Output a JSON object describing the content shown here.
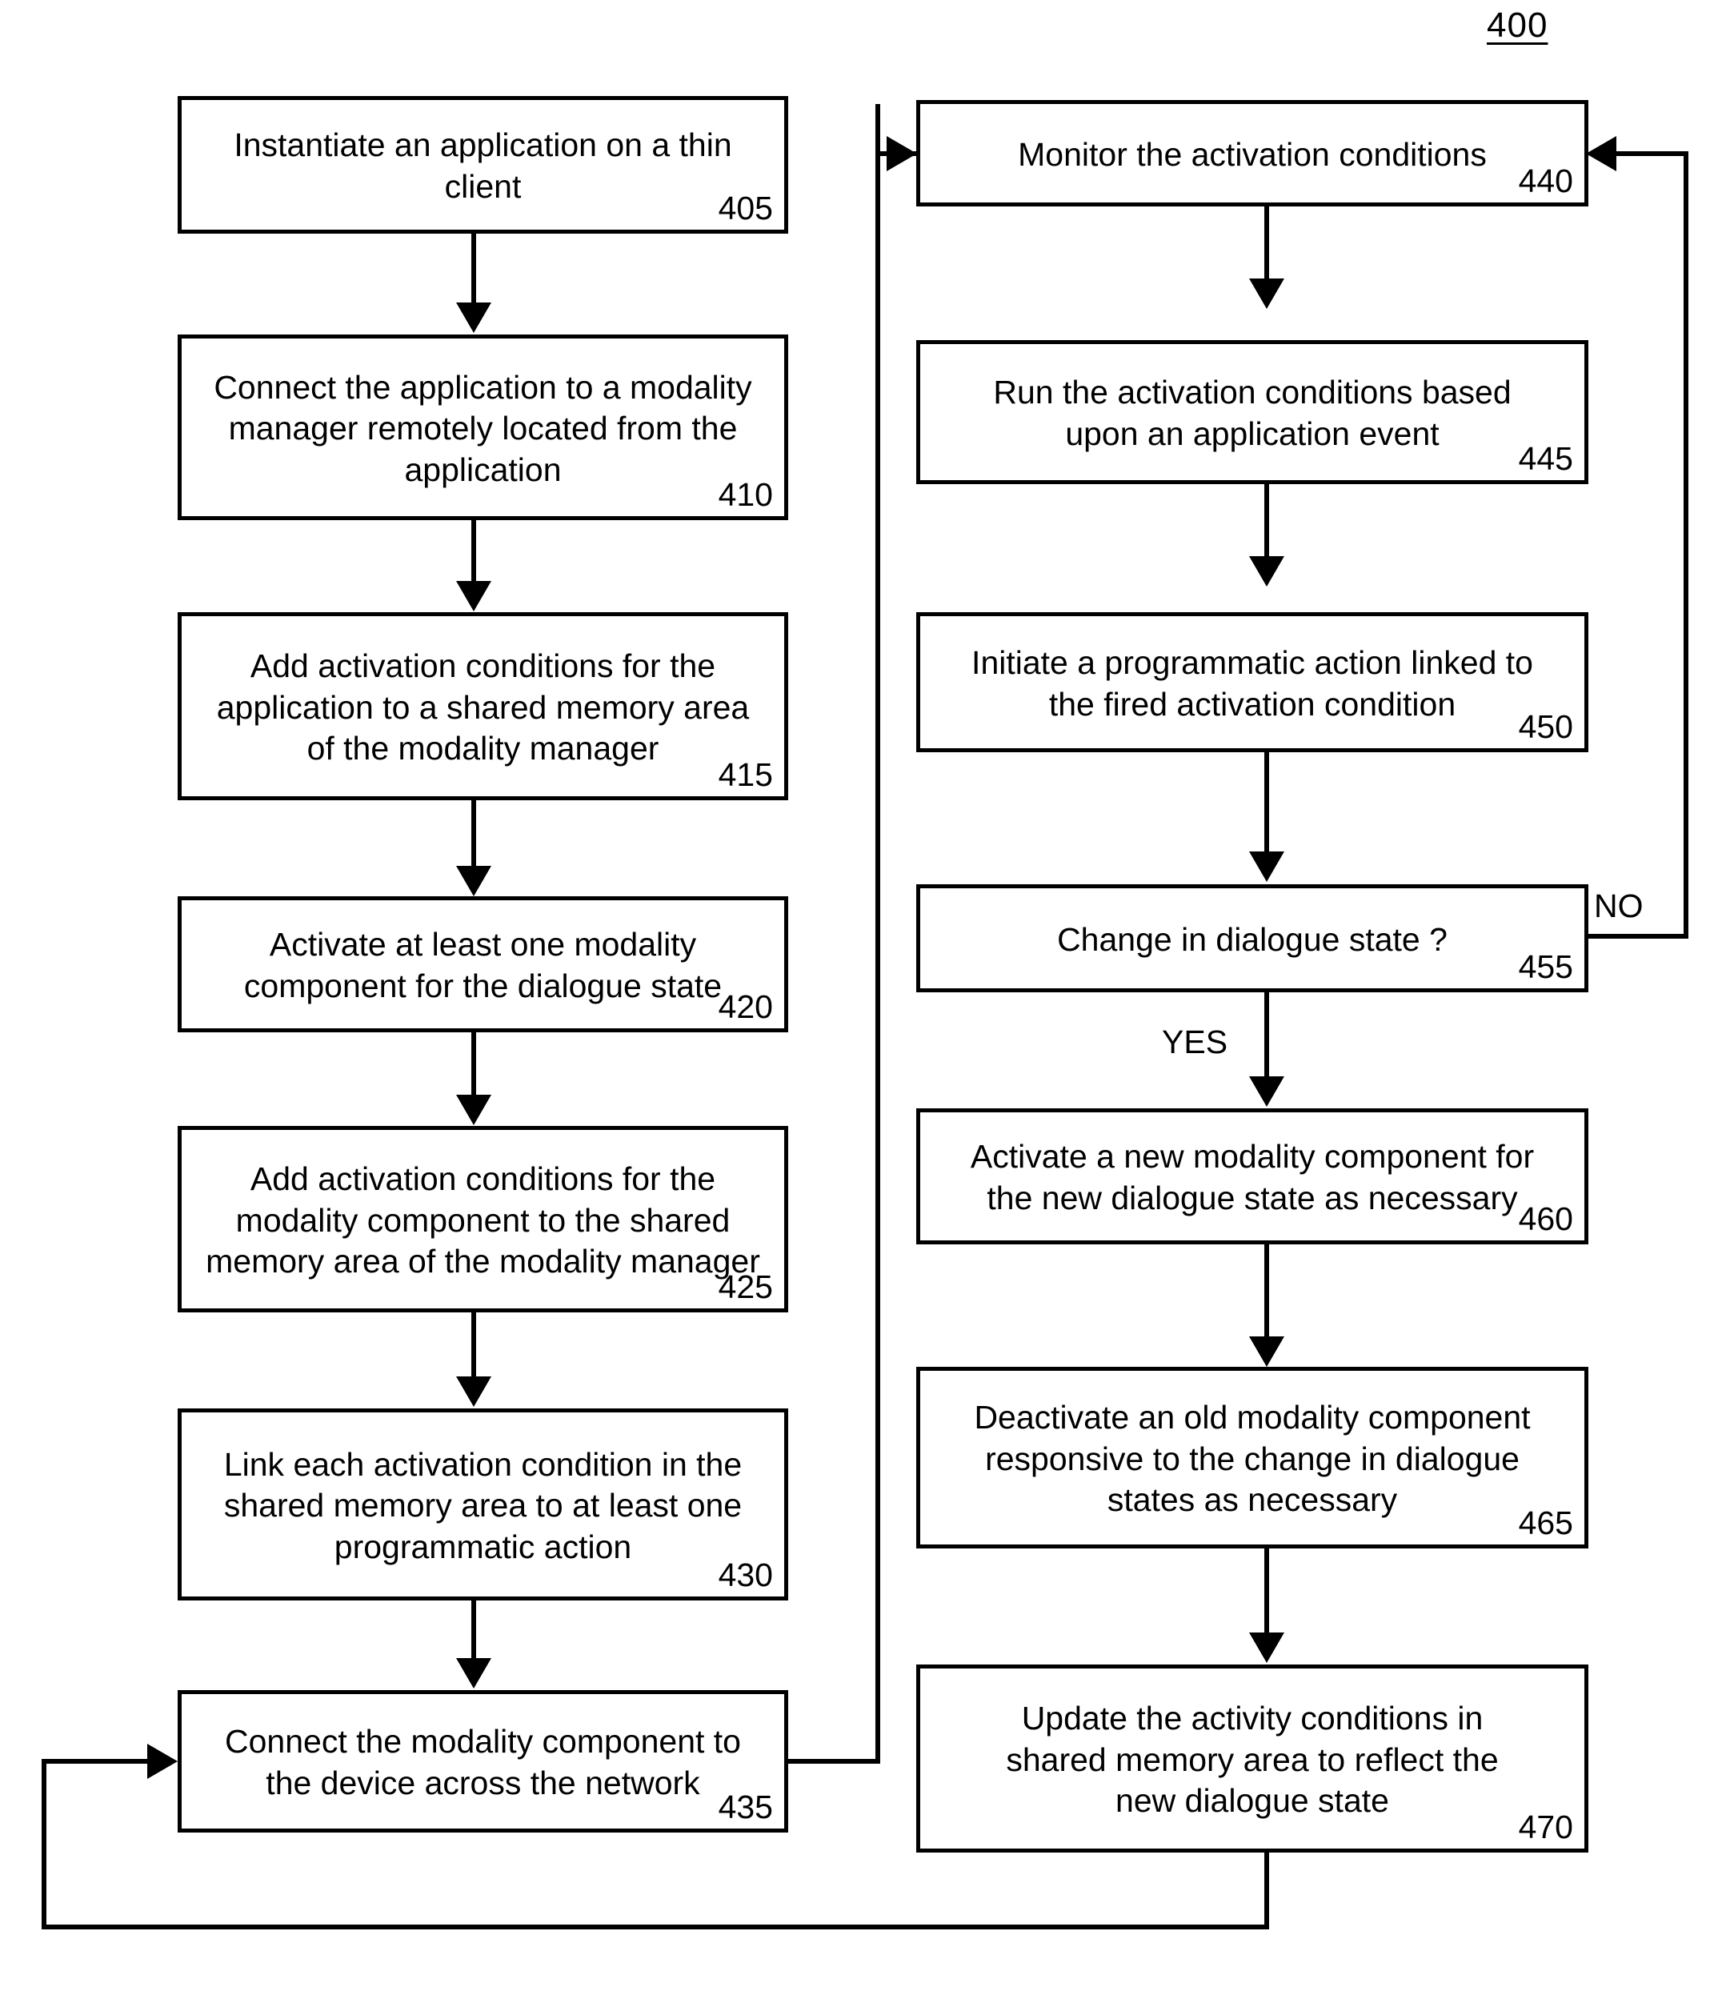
{
  "figure": {
    "number": "400"
  },
  "nodes": [
    {
      "id": "n405",
      "ref": "405",
      "text": "Instantiate an application on a thin\nclient"
    },
    {
      "id": "n410",
      "ref": "410",
      "text": "Connect the application to a modality\nmanager remotely located from the\napplication"
    },
    {
      "id": "n415",
      "ref": "415",
      "text": "Add activation conditions for the\napplication to a shared memory area\nof the modality manager"
    },
    {
      "id": "n420",
      "ref": "420",
      "text": "Activate at least one modality\ncomponent for the dialogue state"
    },
    {
      "id": "n425",
      "ref": "425",
      "text": "Add activation conditions for the\nmodality component to the shared\nmemory area of the modality manager"
    },
    {
      "id": "n430",
      "ref": "430",
      "text": "Link each activation condition in the\nshared memory area to at least one\nprogrammatic action"
    },
    {
      "id": "n435",
      "ref": "435",
      "text": "Connect the modality component to\nthe device across the network"
    },
    {
      "id": "n440",
      "ref": "440",
      "text": "Monitor the activation conditions"
    },
    {
      "id": "n445",
      "ref": "445",
      "text": "Run the activation conditions based\nupon an application event"
    },
    {
      "id": "n450",
      "ref": "450",
      "text": "Initiate a programmatic action linked to\nthe fired activation condition"
    },
    {
      "id": "n455",
      "ref": "455",
      "text": "Change in dialogue state ?"
    },
    {
      "id": "n460",
      "ref": "460",
      "text": "Activate a new modality component for\nthe new dialogue state as necessary"
    },
    {
      "id": "n465",
      "ref": "465",
      "text": "Deactivate an old modality component\nresponsive to the change in dialogue\nstates as necessary"
    },
    {
      "id": "n470",
      "ref": "470",
      "text": "Update the activity conditions in\nshared memory area to reflect the\nnew dialogue state"
    }
  ],
  "branch_labels": {
    "no": "NO",
    "yes": "YES"
  },
  "colors": {
    "stroke": "#000000",
    "background": "#ffffff"
  }
}
